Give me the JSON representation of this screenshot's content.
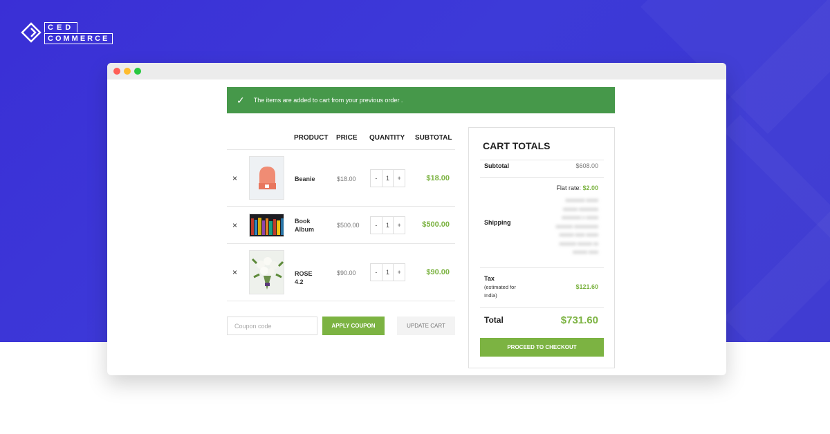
{
  "brand": {
    "top": "CED",
    "bottom": "COMMERCE"
  },
  "notice": {
    "message": "The items are added to cart from your previous order ."
  },
  "table": {
    "headers": [
      "PRODUCT",
      "PRICE",
      "QUANTITY",
      "SUBTOTAL"
    ],
    "items": [
      {
        "name": "Beanie",
        "price": "$18.00",
        "qty": "1",
        "subtotal": "$18.00",
        "image": "beanie-image"
      },
      {
        "name": "Book Album",
        "price": "$500.00",
        "qty": "1",
        "subtotal": "$500.00",
        "image": "book-album-image"
      },
      {
        "name": "ROSE 4.2",
        "price": "$90.00",
        "qty": "1",
        "subtotal": "$90.00",
        "image": "rose-bouquet-image"
      }
    ],
    "remove_symbol": "×",
    "minus": "-",
    "plus": "+"
  },
  "actions": {
    "coupon_placeholder": "Coupon code",
    "apply_label": "APPLY COUPON",
    "update_label": "UPDATE CART"
  },
  "totals": {
    "title": "CART TOTALS",
    "subtotal_label": "Subtotal",
    "subtotal_value": "$608.00",
    "shipping_label": "Shipping",
    "flat_rate_label": "Flat rate:",
    "flat_rate_value": "$2.00",
    "tax_label": "Tax",
    "tax_note": "(estimated for India)",
    "tax_value": "$121.60",
    "total_label": "Total",
    "total_value": "$731.60",
    "checkout_label": "PROCEED TO CHECKOUT"
  },
  "colors": {
    "background": "#3a35d4",
    "notice": "#46984a",
    "accent": "#7cb342"
  }
}
